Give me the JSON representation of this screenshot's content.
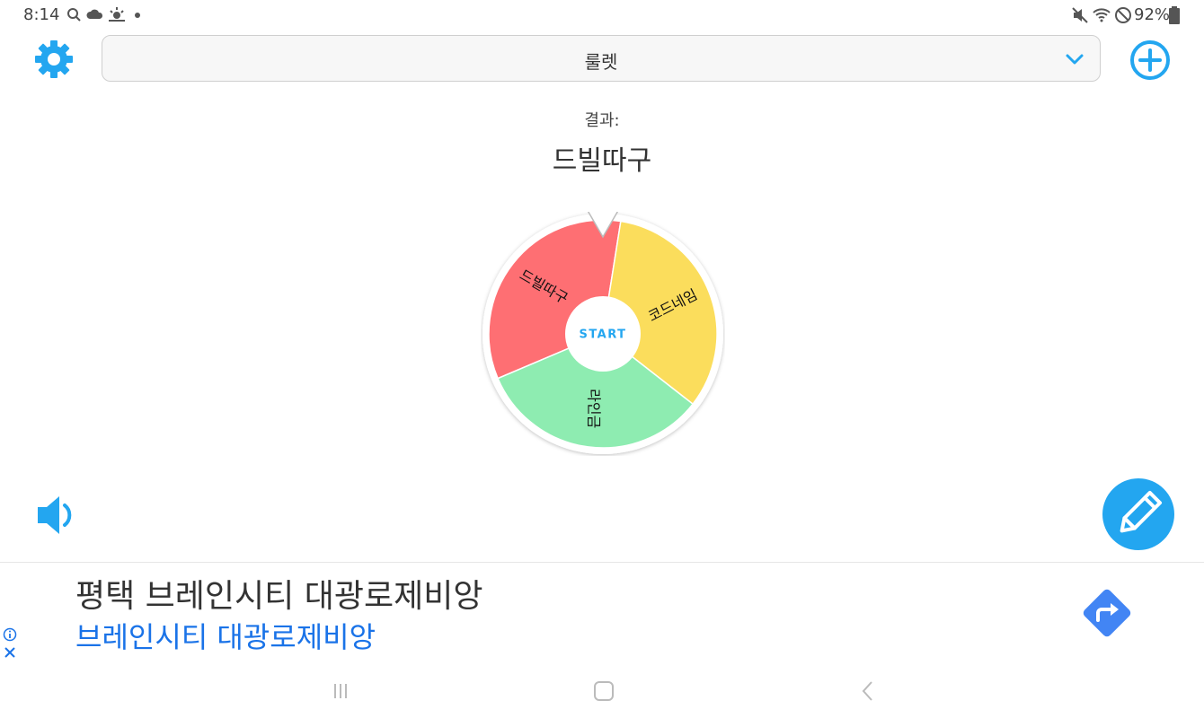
{
  "status_bar": {
    "time": "8:14",
    "battery": "92%",
    "icons": [
      "search-icon",
      "cloud-icon",
      "weather-icon",
      "dot-icon",
      "mute-icon",
      "wifi-icon",
      "do-not-disturb-icon",
      "battery-icon"
    ]
  },
  "header": {
    "select_label": "룰렛"
  },
  "result": {
    "label": "결과:",
    "value": "드빌따구"
  },
  "wheel": {
    "start_label": "START",
    "segments": [
      {
        "label": "드빌따구",
        "color": "#fe6f73"
      },
      {
        "label": "코드네임",
        "color": "#fbdd5c"
      },
      {
        "label": "라인금",
        "color": "#8eecb1"
      }
    ]
  },
  "ad": {
    "title": "평택 브레인시티 대광로제비앙",
    "subtitle": "브레인시티 대광로제비앙"
  },
  "colors": {
    "accent": "#23a6f0",
    "ad_link": "#1a73e8",
    "ad_arrow": "#4285f4"
  }
}
